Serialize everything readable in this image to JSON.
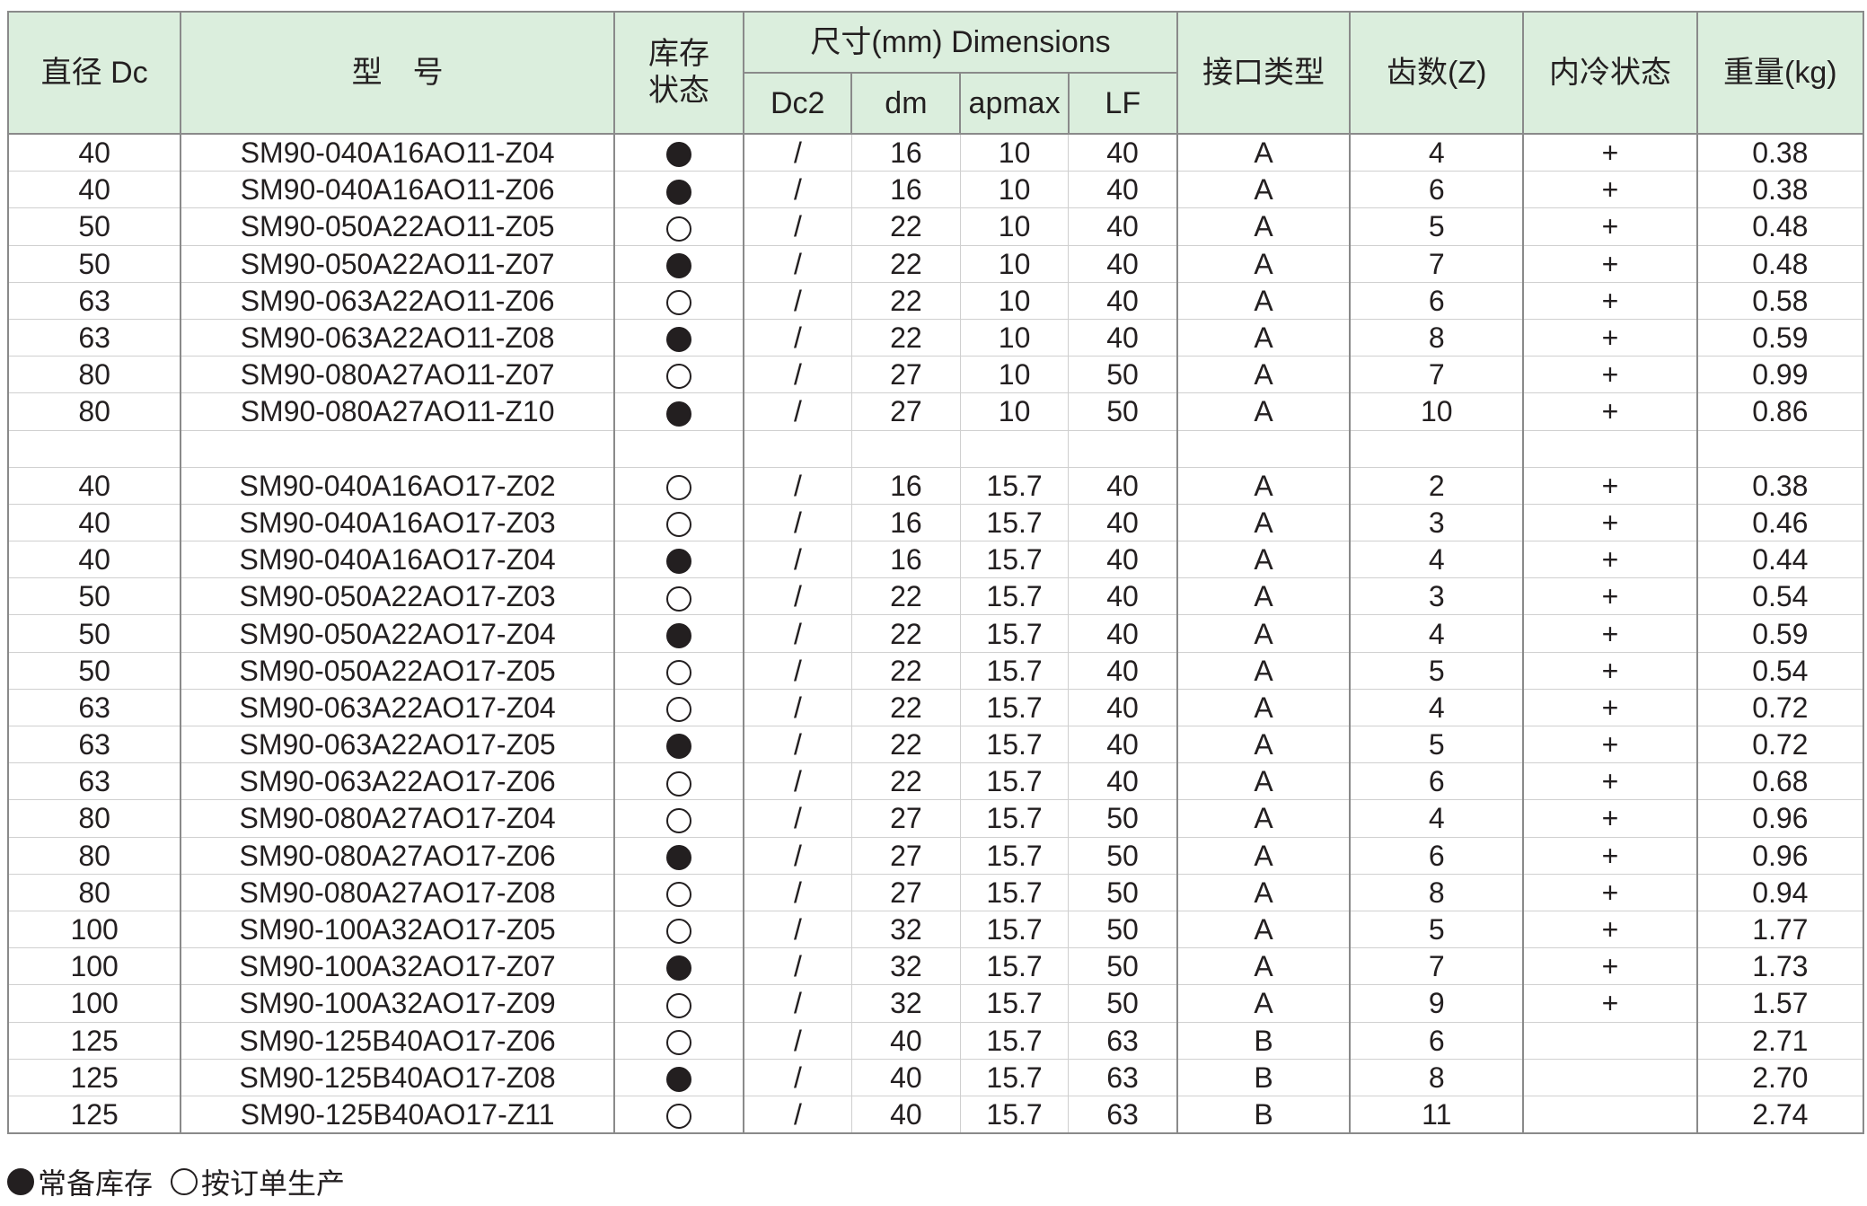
{
  "header": {
    "dc": "直径 Dc",
    "model": "型　号",
    "stock": "库存\n状态",
    "dimensions": "尺寸(mm) Dimensions",
    "dc2": "Dc2",
    "dm": "dm",
    "apmax": "apmax",
    "lf": "LF",
    "interface": "接口类型",
    "teeth": "齿数(Z)",
    "coolant": "内冷状态",
    "weight": "重量(kg)"
  },
  "rows": [
    {
      "dc": "40",
      "model": "SM90-040A16AO11-Z04",
      "stock": "filled",
      "dc2": "/",
      "dm": "16",
      "apmax": "10",
      "lf": "40",
      "iface": "A",
      "z": "4",
      "cool": "+",
      "kg": "0.38"
    },
    {
      "dc": "40",
      "model": "SM90-040A16AO11-Z06",
      "stock": "filled",
      "dc2": "/",
      "dm": "16",
      "apmax": "10",
      "lf": "40",
      "iface": "A",
      "z": "6",
      "cool": "+",
      "kg": "0.38"
    },
    {
      "dc": "50",
      "model": "SM90-050A22AO11-Z05",
      "stock": "hollow",
      "dc2": "/",
      "dm": "22",
      "apmax": "10",
      "lf": "40",
      "iface": "A",
      "z": "5",
      "cool": "+",
      "kg": "0.48"
    },
    {
      "dc": "50",
      "model": "SM90-050A22AO11-Z07",
      "stock": "filled",
      "dc2": "/",
      "dm": "22",
      "apmax": "10",
      "lf": "40",
      "iface": "A",
      "z": "7",
      "cool": "+",
      "kg": "0.48"
    },
    {
      "dc": "63",
      "model": "SM90-063A22AO11-Z06",
      "stock": "hollow",
      "dc2": "/",
      "dm": "22",
      "apmax": "10",
      "lf": "40",
      "iface": "A",
      "z": "6",
      "cool": "+",
      "kg": "0.58"
    },
    {
      "dc": "63",
      "model": "SM90-063A22AO11-Z08",
      "stock": "filled",
      "dc2": "/",
      "dm": "22",
      "apmax": "10",
      "lf": "40",
      "iface": "A",
      "z": "8",
      "cool": "+",
      "kg": "0.59"
    },
    {
      "dc": "80",
      "model": "SM90-080A27AO11-Z07",
      "stock": "hollow",
      "dc2": "/",
      "dm": "27",
      "apmax": "10",
      "lf": "50",
      "iface": "A",
      "z": "7",
      "cool": "+",
      "kg": "0.99"
    },
    {
      "dc": "80",
      "model": "SM90-080A27AO11-Z10",
      "stock": "filled",
      "dc2": "/",
      "dm": "27",
      "apmax": "10",
      "lf": "50",
      "iface": "A",
      "z": "10",
      "cool": "+",
      "kg": "0.86"
    },
    {
      "spacer": true
    },
    {
      "dc": "40",
      "model": "SM90-040A16AO17-Z02",
      "stock": "hollow",
      "dc2": "/",
      "dm": "16",
      "apmax": "15.7",
      "lf": "40",
      "iface": "A",
      "z": "2",
      "cool": "+",
      "kg": "0.38"
    },
    {
      "dc": "40",
      "model": "SM90-040A16AO17-Z03",
      "stock": "hollow",
      "dc2": "/",
      "dm": "16",
      "apmax": "15.7",
      "lf": "40",
      "iface": "A",
      "z": "3",
      "cool": "+",
      "kg": "0.46"
    },
    {
      "dc": "40",
      "model": "SM90-040A16AO17-Z04",
      "stock": "filled",
      "dc2": "/",
      "dm": "16",
      "apmax": "15.7",
      "lf": "40",
      "iface": "A",
      "z": "4",
      "cool": "+",
      "kg": "0.44"
    },
    {
      "dc": "50",
      "model": "SM90-050A22AO17-Z03",
      "stock": "hollow",
      "dc2": "/",
      "dm": "22",
      "apmax": "15.7",
      "lf": "40",
      "iface": "A",
      "z": "3",
      "cool": "+",
      "kg": "0.54"
    },
    {
      "dc": "50",
      "model": "SM90-050A22AO17-Z04",
      "stock": "filled",
      "dc2": "/",
      "dm": "22",
      "apmax": "15.7",
      "lf": "40",
      "iface": "A",
      "z": "4",
      "cool": "+",
      "kg": "0.59"
    },
    {
      "dc": "50",
      "model": "SM90-050A22AO17-Z05",
      "stock": "hollow",
      "dc2": "/",
      "dm": "22",
      "apmax": "15.7",
      "lf": "40",
      "iface": "A",
      "z": "5",
      "cool": "+",
      "kg": "0.54"
    },
    {
      "dc": "63",
      "model": "SM90-063A22AO17-Z04",
      "stock": "hollow",
      "dc2": "/",
      "dm": "22",
      "apmax": "15.7",
      "lf": "40",
      "iface": "A",
      "z": "4",
      "cool": "+",
      "kg": "0.72"
    },
    {
      "dc": "63",
      "model": "SM90-063A22AO17-Z05",
      "stock": "filled",
      "dc2": "/",
      "dm": "22",
      "apmax": "15.7",
      "lf": "40",
      "iface": "A",
      "z": "5",
      "cool": "+",
      "kg": "0.72"
    },
    {
      "dc": "63",
      "model": "SM90-063A22AO17-Z06",
      "stock": "hollow",
      "dc2": "/",
      "dm": "22",
      "apmax": "15.7",
      "lf": "40",
      "iface": "A",
      "z": "6",
      "cool": "+",
      "kg": "0.68"
    },
    {
      "dc": "80",
      "model": "SM90-080A27AO17-Z04",
      "stock": "hollow",
      "dc2": "/",
      "dm": "27",
      "apmax": "15.7",
      "lf": "50",
      "iface": "A",
      "z": "4",
      "cool": "+",
      "kg": "0.96"
    },
    {
      "dc": "80",
      "model": "SM90-080A27AO17-Z06",
      "stock": "filled",
      "dc2": "/",
      "dm": "27",
      "apmax": "15.7",
      "lf": "50",
      "iface": "A",
      "z": "6",
      "cool": "+",
      "kg": "0.96"
    },
    {
      "dc": "80",
      "model": "SM90-080A27AO17-Z08",
      "stock": "hollow",
      "dc2": "/",
      "dm": "27",
      "apmax": "15.7",
      "lf": "50",
      "iface": "A",
      "z": "8",
      "cool": "+",
      "kg": "0.94"
    },
    {
      "dc": "100",
      "model": "SM90-100A32AO17-Z05",
      "stock": "hollow",
      "dc2": "/",
      "dm": "32",
      "apmax": "15.7",
      "lf": "50",
      "iface": "A",
      "z": "5",
      "cool": "+",
      "kg": "1.77"
    },
    {
      "dc": "100",
      "model": "SM90-100A32AO17-Z07",
      "stock": "filled",
      "dc2": "/",
      "dm": "32",
      "apmax": "15.7",
      "lf": "50",
      "iface": "A",
      "z": "7",
      "cool": "+",
      "kg": "1.73"
    },
    {
      "dc": "100",
      "model": "SM90-100A32AO17-Z09",
      "stock": "hollow",
      "dc2": "/",
      "dm": "32",
      "apmax": "15.7",
      "lf": "50",
      "iface": "A",
      "z": "9",
      "cool": "+",
      "kg": "1.57"
    },
    {
      "dc": "125",
      "model": "SM90-125B40AO17-Z06",
      "stock": "hollow",
      "dc2": "/",
      "dm": "40",
      "apmax": "15.7",
      "lf": "63",
      "iface": "B",
      "z": "6",
      "cool": "",
      "kg": "2.71"
    },
    {
      "dc": "125",
      "model": "SM90-125B40AO17-Z08",
      "stock": "filled",
      "dc2": "/",
      "dm": "40",
      "apmax": "15.7",
      "lf": "63",
      "iface": "B",
      "z": "8",
      "cool": "",
      "kg": "2.70"
    },
    {
      "dc": "125",
      "model": "SM90-125B40AO17-Z11",
      "stock": "hollow",
      "dc2": "/",
      "dm": "40",
      "apmax": "15.7",
      "lf": "63",
      "iface": "B",
      "z": "11",
      "cool": "",
      "kg": "2.74"
    }
  ],
  "legend": {
    "in_stock": "常备库存",
    "made_to_order": "按订单生产"
  }
}
